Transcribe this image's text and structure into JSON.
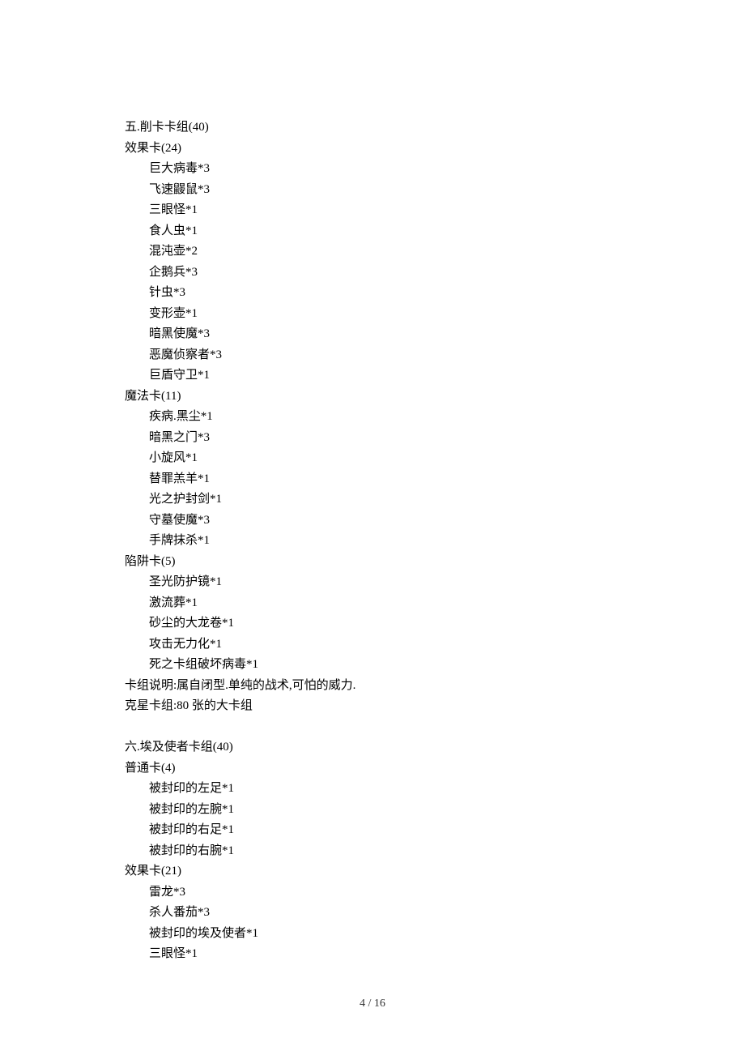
{
  "deck5": {
    "title": "五.削卡卡组(40)",
    "sections": [
      {
        "header": "效果卡(24)",
        "items": [
          "巨大病毒*3",
          "飞速鼹鼠*3",
          "三眼怪*1",
          "食人虫*1",
          "混沌壶*2",
          "企鹅兵*3",
          "针虫*3",
          "变形壶*1",
          "暗黑使魔*3",
          "恶魔侦察者*3",
          "巨盾守卫*1"
        ]
      },
      {
        "header": "魔法卡(11)",
        "items": [
          "疾病.黑尘*1",
          "暗黑之门*3",
          "小旋风*1",
          "替罪羔羊*1",
          "光之护封剑*1",
          "守墓使魔*3",
          "手牌抹杀*1"
        ]
      },
      {
        "header": "陷阱卡(5)",
        "items": [
          "圣光防护镜*1",
          "激流葬*1",
          "砂尘的大龙卷*1",
          "攻击无力化*1",
          "死之卡组破坏病毒*1"
        ]
      }
    ],
    "note": "卡组说明:属自闭型.单纯的战术,可怕的威力.",
    "counter": "克星卡组:80 张的大卡组"
  },
  "deck6": {
    "title": "六.埃及使者卡组(40)",
    "sections": [
      {
        "header": "普通卡(4)",
        "items": [
          "被封印的左足*1",
          "被封印的左腕*1",
          "被封印的右足*1",
          "被封印的右腕*1"
        ]
      },
      {
        "header": "效果卡(21)",
        "items": [
          "雷龙*3",
          "杀人番茄*3",
          "被封印的埃及使者*1",
          "三眼怪*1"
        ]
      }
    ]
  },
  "footer": {
    "page": "4  /  16"
  }
}
